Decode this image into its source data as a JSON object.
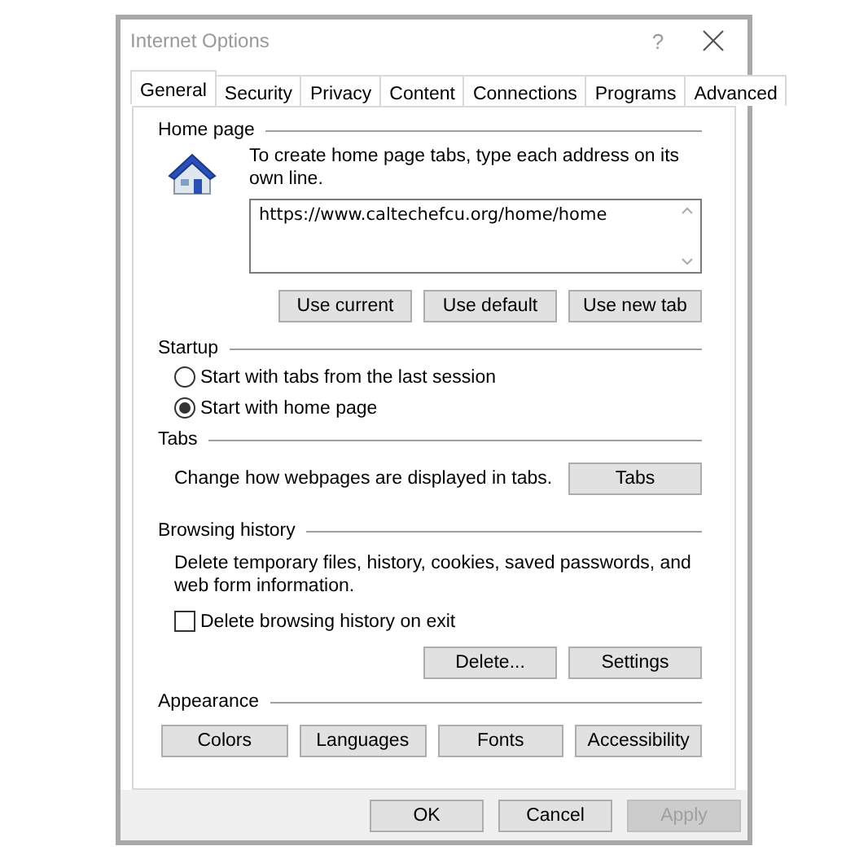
{
  "window": {
    "title": "Internet Options",
    "help": "?"
  },
  "tabs": [
    {
      "label": "General",
      "selected": true
    },
    {
      "label": "Security",
      "selected": false
    },
    {
      "label": "Privacy",
      "selected": false
    },
    {
      "label": "Content",
      "selected": false
    },
    {
      "label": "Connections",
      "selected": false
    },
    {
      "label": "Programs",
      "selected": false
    },
    {
      "label": "Advanced",
      "selected": false
    }
  ],
  "home_page": {
    "heading": "Home page",
    "description": "To create home page tabs, type each address on its own line.",
    "addresses": "https://www.caltechefcu.org/home/home",
    "buttons": [
      "Use current",
      "Use default",
      "Use new tab"
    ]
  },
  "startup": {
    "heading": "Startup",
    "options": [
      {
        "label": "Start with tabs from the last session",
        "selected": false
      },
      {
        "label": "Start with home page",
        "selected": true
      }
    ]
  },
  "tabs_section": {
    "heading": "Tabs",
    "description": "Change how webpages are displayed in tabs.",
    "button": "Tabs"
  },
  "browsing_history": {
    "heading": "Browsing history",
    "description": "Delete temporary files, history, cookies, saved passwords, and web form information.",
    "checkbox": {
      "label": "Delete browsing history on exit",
      "checked": false
    },
    "buttons": [
      "Delete...",
      "Settings"
    ]
  },
  "appearance": {
    "heading": "Appearance",
    "buttons": [
      "Colors",
      "Languages",
      "Fonts",
      "Accessibility"
    ]
  },
  "footer_buttons": [
    {
      "label": "OK",
      "disabled": false
    },
    {
      "label": "Cancel",
      "disabled": false
    },
    {
      "label": "Apply",
      "disabled": true
    }
  ]
}
